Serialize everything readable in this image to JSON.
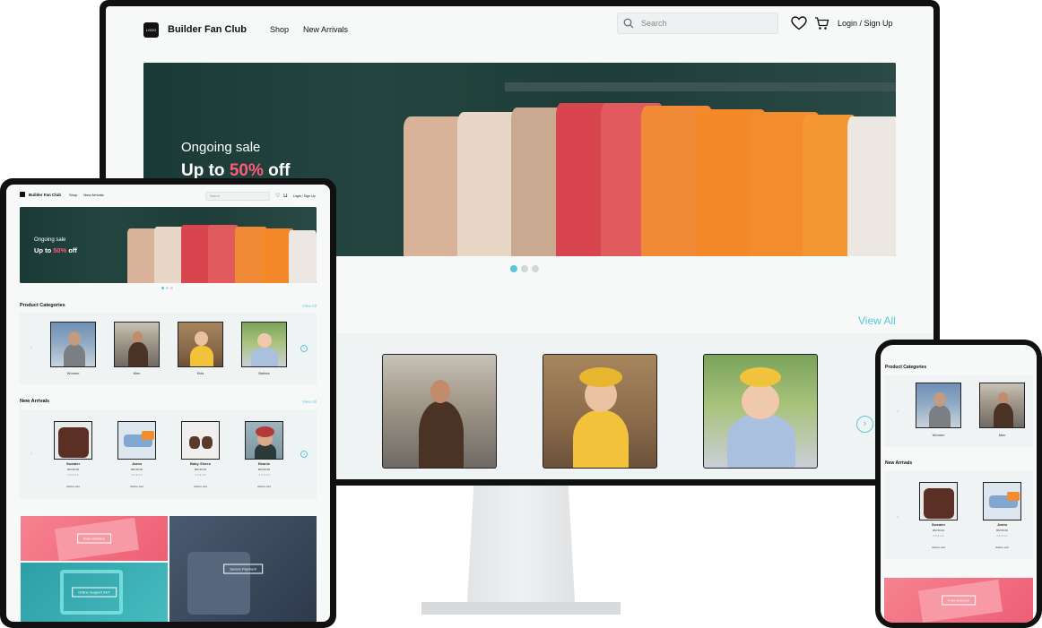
{
  "brand": {
    "name": "Builder Fan Club",
    "logo_text": "LOGO"
  },
  "nav": {
    "links": [
      "Shop",
      "New Arrivals"
    ],
    "search_placeholder": "Search",
    "login": "Login / Sign Up"
  },
  "hero": {
    "line1": "Ongoing sale",
    "line2_prefix": "Up to ",
    "line2_highlight": "50%",
    "line2_suffix": " off",
    "slides": 3,
    "active_slide": 1
  },
  "categories": {
    "title": "Product Categories",
    "view_all": "View All",
    "items": [
      "Women",
      "Men",
      "Kids",
      "Babies"
    ]
  },
  "new_arrivals": {
    "title": "New Arrivals",
    "view_all": "View All",
    "add_to_cart": "Add to cart",
    "items": [
      {
        "name": "Sweater",
        "price": "RM 50.00",
        "options": "0.5 ● 2.0"
      },
      {
        "name": "Jeans",
        "price": "RM 50.00",
        "options": "0.5 ● 5.0"
      },
      {
        "name": "Baby Shoes",
        "price": "RM 50.00",
        "options": "0.5 ● 4.0"
      },
      {
        "name": "Beanie",
        "price": "RM 50.00",
        "options": "0.5 ● 4.0"
      }
    ]
  },
  "promos": [
    "Free Delivery",
    "Secure Payment",
    "Online Support 24/7"
  ],
  "colors": {
    "accent": "#5ac7d9",
    "sale": "#ff5b7b",
    "promo_pink": "#f36a7e",
    "promo_teal": "#3aa7ad",
    "promo_navy": "#3b4a5e"
  }
}
